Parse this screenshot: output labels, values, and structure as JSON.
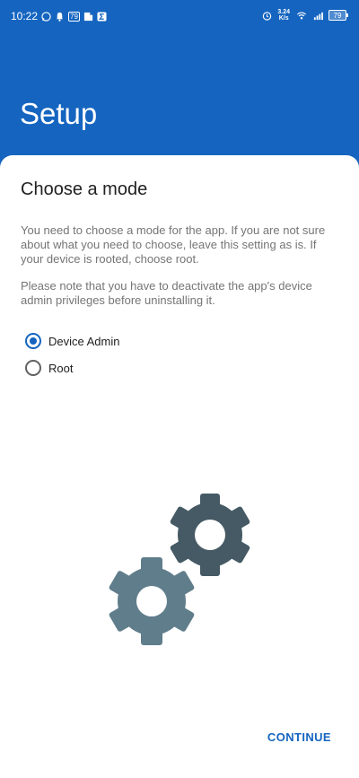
{
  "status_bar": {
    "time": "10:22",
    "left_icons": [
      "whatsapp-icon",
      "notification-bell-icon",
      "badge-icon",
      "sim-icon",
      "sigma-app-icon"
    ],
    "badge_text": "79",
    "net_speed_value": "3.24",
    "net_speed_unit": "K/s",
    "right_icons": [
      "alarm-icon",
      "wifi-icon",
      "signal-icon",
      "battery-icon"
    ],
    "battery_level": "79"
  },
  "header": {
    "title": "Setup"
  },
  "card": {
    "title": "Choose a mode",
    "description_1": "You need to choose a mode for the app. If you are not sure about what you need to choose, leave this setting as is. If your device is rooted, choose root.",
    "description_2": "Please note that you have to deactivate the app's device admin privileges before uninstalling it.",
    "options": [
      {
        "label": "Device Admin",
        "checked": true
      },
      {
        "label": "Root",
        "checked": false
      }
    ],
    "illustration": "gears-icon",
    "continue_label": "CONTINUE"
  },
  "colors": {
    "primary": "#1565C0",
    "gear_dark": "#455A64",
    "gear_light": "#607D8B"
  }
}
